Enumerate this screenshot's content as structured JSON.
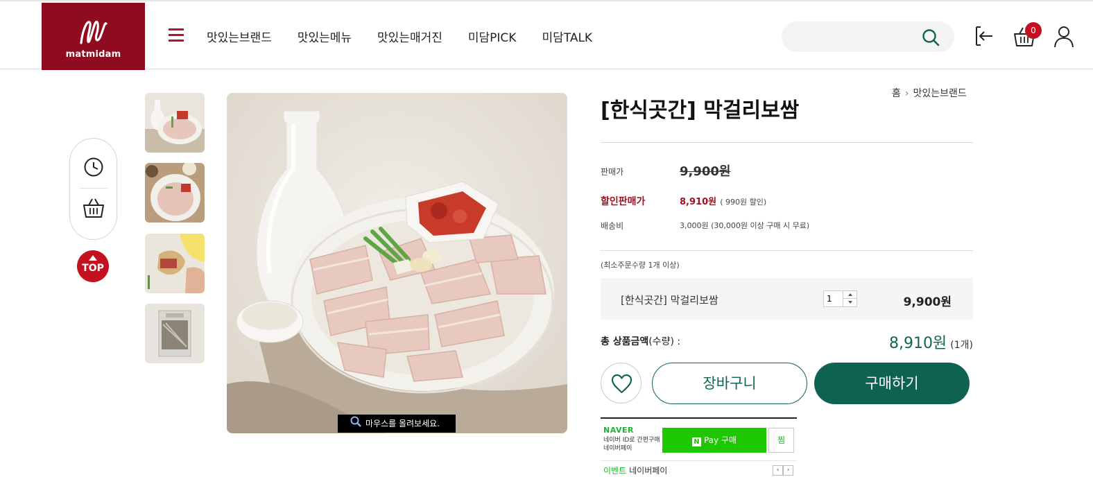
{
  "header": {
    "logo_text": "matmidam",
    "nav": [
      "맛있는브랜드",
      "맛있는메뉴",
      "맛있는매거진",
      "미담PICK",
      "미담TALK"
    ],
    "search_placeholder": "",
    "cart_count": "0"
  },
  "quickbar": {
    "top_label": "TOP"
  },
  "gallery": {
    "zoom_hint": "마우스를 올려보세요."
  },
  "product": {
    "title": "[한식곳간] 막걸리보쌈",
    "breadcrumb": [
      "홈",
      "맛있는브랜드"
    ],
    "price_label": "판매가",
    "price": "9,900원",
    "sale_label": "할인판매가",
    "sale_price": "8,910원",
    "sale_note": "( 990원 할인)",
    "shipping_label": "배송비",
    "shipping": "3,000원 (30,000원 이상 구매 시 무료)",
    "min_order": "(최소주문수량 1개 이상)",
    "option": {
      "name": "[한식곳간] 막걸리보쌈",
      "qty": "1",
      "price": "9,900원"
    },
    "total_label": "총 상품금액",
    "total_sub": "(수량) :",
    "total_amount": "8,910원",
    "total_count": "(1개)",
    "cart_button": "장바구니",
    "buy_button": "구매하기"
  },
  "naverpay": {
    "brand": "NAVER",
    "desc": "네이버 ID로 간편구매 네이버페이",
    "pay_label": "Pay 구매",
    "zzim": "찜",
    "event_tag": "이벤트",
    "event_text": "네이버페이"
  },
  "colors": {
    "brand_red": "#8e0b20",
    "accent_green": "#0f6252",
    "sale_red": "#a0111f",
    "naver_green": "#1ec800"
  }
}
